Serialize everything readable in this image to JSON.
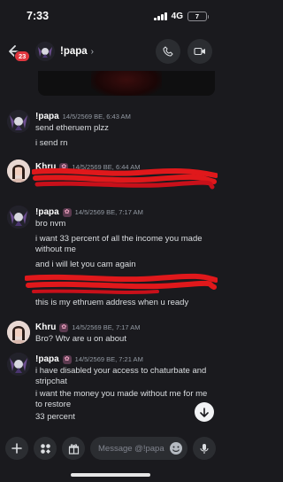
{
  "status_bar": {
    "time": "7:33",
    "network": "4G",
    "battery_level": "7"
  },
  "header": {
    "unread_badge": "23",
    "channel_name": "!papa",
    "chevron": "›"
  },
  "messages": [
    {
      "author": "!papa",
      "has_role_icon": false,
      "timestamp": "14/5/2569 BE, 6:43 AM",
      "lines": [
        "send etheruem plzz",
        "i send rn"
      ]
    },
    {
      "author": "Khru",
      "has_role_icon": true,
      "timestamp": "14/5/2569 BE, 6:44 AM",
      "lines": []
    },
    {
      "author": "!papa",
      "has_role_icon": true,
      "timestamp": "14/5/2569 BE, 7:17 AM",
      "lines": [
        "bro nvm",
        "i want 33 percent of  all the income you made without me",
        "and i will let you cam again",
        "this is my ethruem address when u ready"
      ]
    },
    {
      "author": "Khru",
      "has_role_icon": true,
      "timestamp": "14/5/2569 BE, 7:17 AM",
      "lines": [
        "Bro? Wtv are u on about"
      ]
    },
    {
      "author": "!papa",
      "has_role_icon": true,
      "timestamp": "14/5/2569 BE, 7:21 AM",
      "lines": [
        "i have disabled your access to chaturbate and stripchat",
        "i want the money you made without me for me to restore",
        "33 percent"
      ]
    }
  ],
  "composer": {
    "placeholder": "Message @!papa"
  },
  "colors": {
    "background": "#1a1a1e",
    "redaction": "#e0181b",
    "badge": "#e0363e"
  }
}
